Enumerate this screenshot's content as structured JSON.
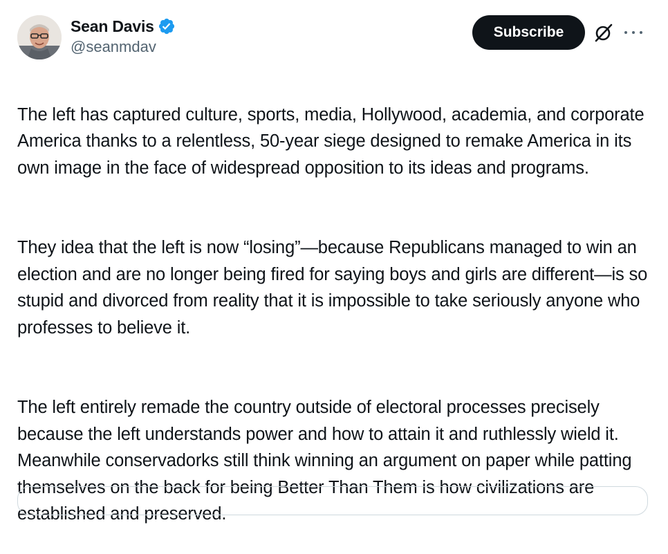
{
  "author": {
    "display_name": "Sean Davis",
    "handle": "@seanmdav",
    "verified": true,
    "avatar_icon": "profile-photo"
  },
  "actions": {
    "subscribe_label": "Subscribe",
    "grok_icon": "grok-slash-icon",
    "more_icon": "more-dots-icon"
  },
  "tweet": {
    "paragraphs": [
      "The left has captured culture, sports, media, Hollywood, academia, and corporate America thanks to a relentless, 50-year siege designed to remake America in its own image in the face of widespread opposition to its ideas and programs.",
      "They idea that the left is now “losing”—because Republicans managed to win an election and are no longer being fired for saying boys and girls are different—is so stupid and divorced from reality that it is impossible to take seriously anyone who professes to believe it.",
      "The left entirely remade the country outside of electoral processes precisely because the left understands power and how to attain it and ruthlessly wield it. Meanwhile conservadorks still think winning an argument on paper while patting themselves on the back for being Better Than Them is how civilizations are established and preserved."
    ]
  },
  "colors": {
    "text": "#0f1419",
    "secondary_text": "#536471",
    "verified_blue": "#1d9bf0",
    "button_bg": "#0f1419",
    "border": "#cfd9de"
  }
}
